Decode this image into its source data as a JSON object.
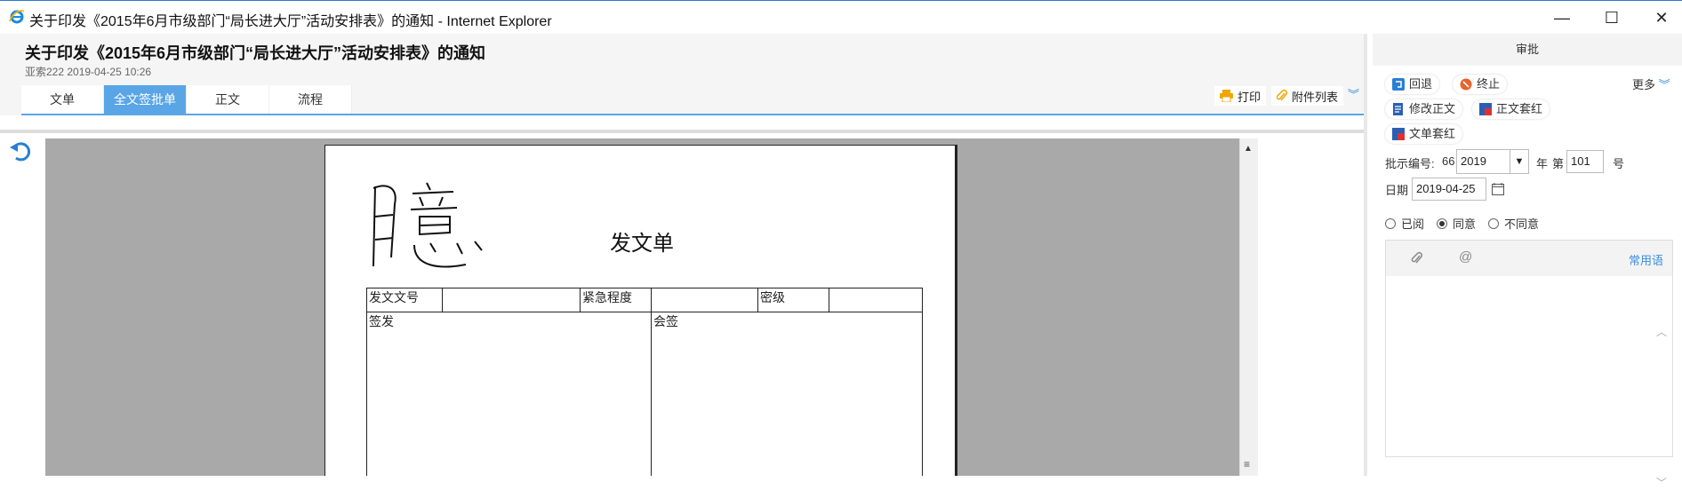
{
  "window": {
    "title": "关于印发《2015年6月市级部门“局长进大厅”活动安排表》的通知 - Internet Explorer",
    "controls": {
      "minimize": "—",
      "maximize": "☐",
      "close": "✕"
    }
  },
  "header": {
    "title": "关于印发《2015年6月市级部门“局长进大厅”活动安排表》的通知",
    "meta": "亚索222 2019-04-25 10:26",
    "tabs": [
      {
        "label": "文单",
        "active": false
      },
      {
        "label": "全文签批单",
        "active": true
      },
      {
        "label": "正文",
        "active": false
      },
      {
        "label": "流程",
        "active": false
      }
    ],
    "print_label": "打印",
    "attach_label": "附件列表"
  },
  "document": {
    "heading": "发文单",
    "table": {
      "doc_number_label": "发文文号",
      "urgency_label": "紧急程度",
      "security_label": "密级",
      "sign_label": "签发",
      "countersign_label": "会签"
    }
  },
  "panel": {
    "title": "审批",
    "buttons": {
      "return": "回退",
      "terminate": "终止",
      "more": "更多",
      "edit_body": "修改正文",
      "body_redhead": "正文套红",
      "doc_redhead": "文单套红"
    },
    "instruction_number": {
      "label": "批示编号:",
      "prefix": "66",
      "year": "2019",
      "year_suffix": "年",
      "number_prefix": "第",
      "number": "101",
      "number_suffix": "号"
    },
    "date": {
      "label": "日期",
      "value": "2019-04-25"
    },
    "opinion_choice": [
      {
        "label": "已阅",
        "selected": false
      },
      {
        "label": "同意",
        "selected": true
      },
      {
        "label": "不同意",
        "selected": false
      }
    ],
    "common_phrases": "常用语"
  },
  "colors": {
    "accent": "#5aa5e6",
    "link": "#3a8de0",
    "viewer_bg": "#a9a9a9"
  }
}
